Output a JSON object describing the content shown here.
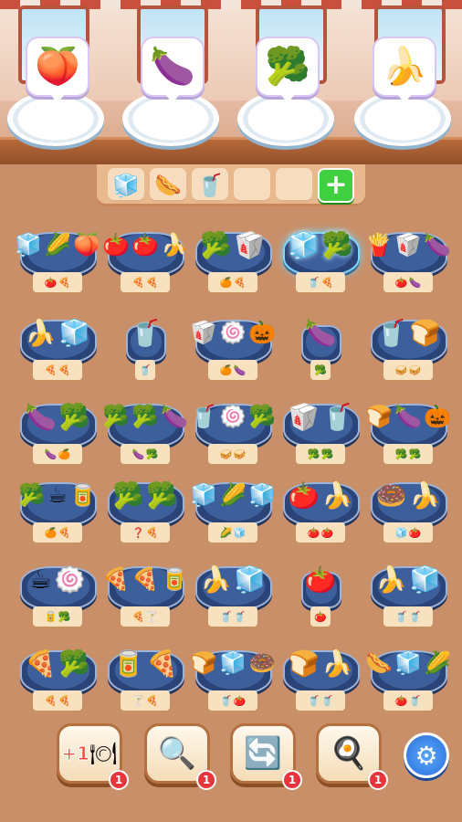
{
  "orders": [
    {
      "icon": "🍑",
      "icon_name": "peach-icon"
    },
    {
      "icon": "🍆",
      "icon_name": "eggplant-icon"
    },
    {
      "icon": "🥦",
      "icon_name": "broccoli-icon"
    },
    {
      "icon": "🍌",
      "icon_name": "banana-icon"
    }
  ],
  "tray": {
    "slots": [
      "🧊",
      "🌭",
      "🥤",
      "",
      ""
    ],
    "add_icon": "+"
  },
  "stations": [
    {
      "items": [
        "🧊",
        "🌽",
        "🍑"
      ],
      "base": [
        "🍅",
        "🍕"
      ]
    },
    {
      "items": [
        "🍅",
        "🍅",
        "🍌"
      ],
      "base": [
        "🍕",
        "🍕"
      ]
    },
    {
      "items": [
        "🥦",
        "🥡"
      ],
      "base": [
        "🍊",
        "🍕"
      ]
    },
    {
      "items": [
        "🧊",
        "🥦"
      ],
      "base": [
        "🥤",
        "🍕"
      ],
      "glass": true
    },
    {
      "items": [
        "🍟",
        "🥡",
        "🍆"
      ],
      "base": [
        "🍅",
        "🍆"
      ]
    },
    {
      "items": [
        "🍌",
        "🧊"
      ],
      "base": [
        "🍕",
        "🍕"
      ]
    },
    {
      "items": [
        "🥤"
      ],
      "base": [
        "🥤"
      ],
      "small": true
    },
    {
      "items": [
        "🥡",
        "🍥",
        "🎃"
      ],
      "base": [
        "🍊",
        "🍆"
      ]
    },
    {
      "items": [
        "🍆"
      ],
      "base": [
        "🥦"
      ],
      "small": true
    },
    {
      "items": [
        "🥤",
        "🍞"
      ],
      "base": [
        "🥪",
        "🥪"
      ]
    },
    {
      "items": [
        "🍆",
        "🥦"
      ],
      "base": [
        "🍆",
        "🍊"
      ]
    },
    {
      "items": [
        "🥦",
        "🥦",
        "🍆"
      ],
      "base": [
        "🍆",
        "🥦"
      ]
    },
    {
      "items": [
        "🥤",
        "🍥",
        "🥦"
      ],
      "base": [
        "🥪",
        "🥪"
      ]
    },
    {
      "items": [
        "🥡",
        "🥤"
      ],
      "base": [
        "🥦",
        "🥦"
      ]
    },
    {
      "items": [
        "🍞",
        "🍆",
        "🎃"
      ],
      "base": [
        "🥦",
        "🥦"
      ]
    },
    {
      "items": [
        "🥦",
        "☕",
        "🥫"
      ],
      "base": [
        "🍊",
        "🍕"
      ]
    },
    {
      "items": [
        "🥦",
        "🥦"
      ],
      "base": [
        "❓",
        "🍕"
      ]
    },
    {
      "items": [
        "🧊",
        "🌽",
        "🧊"
      ],
      "base": [
        "🌽",
        "🧊"
      ]
    },
    {
      "items": [
        "🍅",
        "🍌"
      ],
      "base": [
        "🍅",
        "🍅"
      ]
    },
    {
      "items": [
        "🍩",
        "🍌"
      ],
      "base": [
        "🧊",
        "🍅"
      ]
    },
    {
      "items": [
        "☕",
        "🍥"
      ],
      "base": [
        "🥫",
        "🥦"
      ]
    },
    {
      "items": [
        "🍕",
        "🍕",
        "🥫"
      ],
      "base": [
        "🍕",
        "🍸"
      ]
    },
    {
      "items": [
        "🍌",
        "🧊"
      ],
      "base": [
        "🥤",
        "🥤"
      ]
    },
    {
      "items": [
        "🍅"
      ],
      "base": [
        "🍅"
      ],
      "small": true
    },
    {
      "items": [
        "🍌",
        "🧊"
      ],
      "base": [
        "🥤",
        "🥤"
      ]
    },
    {
      "items": [
        "🍕",
        "🥦"
      ],
      "base": [
        "🍕",
        "🍕"
      ]
    },
    {
      "items": [
        "🥫",
        "🍕"
      ],
      "base": [
        "🍸",
        "🍕"
      ]
    },
    {
      "items": [
        "🍞",
        "🧊",
        "🍩"
      ],
      "base": [
        "🥤",
        "🍅"
      ]
    },
    {
      "items": [
        "🍞",
        "🍌"
      ],
      "base": [
        "🥤",
        "🥤"
      ]
    },
    {
      "items": [
        "🌭",
        "🧊",
        "🌽"
      ],
      "base": [
        "🍅",
        "🥤"
      ]
    }
  ],
  "tools": [
    {
      "name": "extra-plate",
      "label": "+1",
      "icon": "🍽",
      "count": "1"
    },
    {
      "name": "magnifier",
      "icon": "🔍",
      "count": "1"
    },
    {
      "name": "shuffle",
      "icon": "🔄",
      "count": "1"
    },
    {
      "name": "spatula",
      "icon": "🍳",
      "count": "1"
    }
  ],
  "settings_icon": "⚙"
}
